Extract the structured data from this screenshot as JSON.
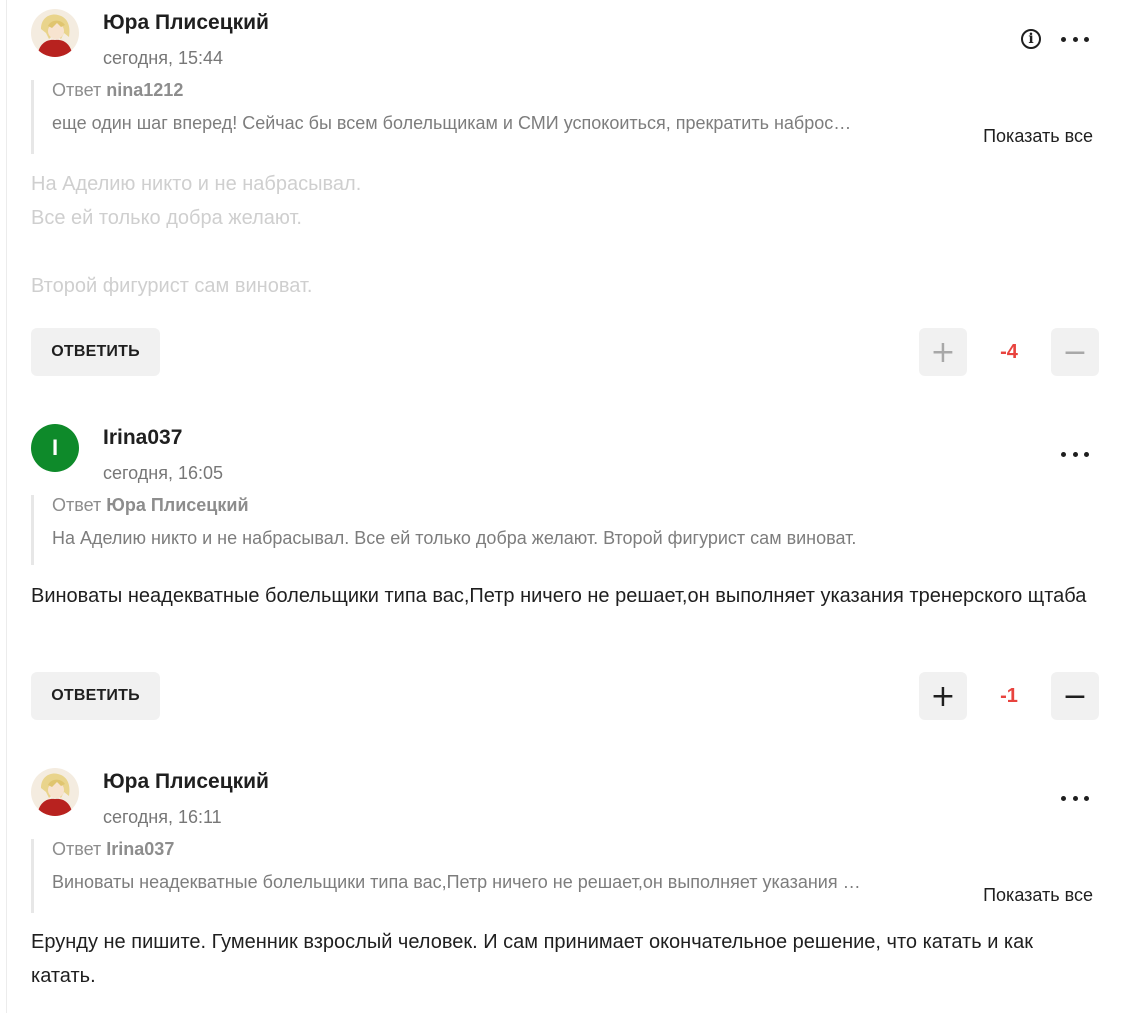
{
  "comments": [
    {
      "author": "Юра Плисецкий",
      "time": "сегодня, 15:44",
      "avatar": "anime-avatar",
      "quote_prefix": "Ответ",
      "quote_author": "nina1212",
      "quote_text": "еще один шаг вперед! Сейчас бы всем болельщикам и СМИ успокоиться, прекратить наброс…",
      "show_all": "Показать все",
      "body_lines": [
        "На Аделию никто и не набрасывал.",
        "Все ей только добра желают.",
        "",
        "Второй фигурист сам виноват."
      ],
      "reply_label": "ОТВЕТИТЬ",
      "score": "-4",
      "icons": [
        "info-icon",
        "more-icon",
        "plus-icon",
        "minus-icon"
      ]
    },
    {
      "author": "Irina037",
      "time": "сегодня, 16:05",
      "avatar_letter": "I",
      "quote_prefix": "Ответ",
      "quote_author": "Юра Плисецкий",
      "quote_text": "На Аделию никто и не набрасывал. Все ей только добра желают. Второй фигурист сам виноват.",
      "body": "Виноваты неадекватные болельщики типа вас,Петр ничего не решает,он выполняет указания тренерского щтаба",
      "reply_label": "ОТВЕТИТЬ",
      "score": "-1",
      "icons": [
        "more-icon",
        "plus-icon",
        "minus-icon"
      ]
    },
    {
      "author": "Юра Плисецкий",
      "time": "сегодня, 16:11",
      "avatar": "anime-avatar",
      "quote_prefix": "Ответ",
      "quote_author": "Irina037",
      "quote_text": "Виноваты неадекватные болельщики типа вас,Петр ничего не решает,он выполняет указания …",
      "show_all": "Показать все",
      "body": "Ерунду не пишите. Гуменник взрослый человек. И сам принимает окончательное решение, что катать и как катать.",
      "icons": [
        "more-icon"
      ]
    }
  ],
  "colors": {
    "score": "#e8433e",
    "avatar_green": "#0e8a2a",
    "button_bg": "#f1f1f1"
  }
}
